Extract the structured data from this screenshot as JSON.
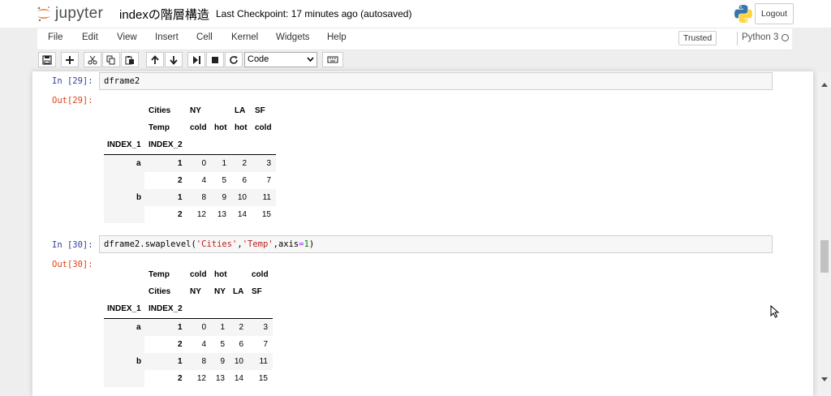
{
  "header": {
    "logo_text": "jupyter",
    "notebook_title": "indexの階層構造",
    "checkpoint_text": "Last Checkpoint: 17 minutes ago (autosaved)",
    "logout_label": "Logout"
  },
  "menu": {
    "items": [
      "File",
      "Edit",
      "View",
      "Insert",
      "Cell",
      "Kernel",
      "Widgets",
      "Help"
    ],
    "trusted_label": "Trusted",
    "kernel_name": "Python 3"
  },
  "toolbar": {
    "buttons": [
      "save-icon",
      "add-cell-icon",
      "cut-icon",
      "copy-icon",
      "paste-icon",
      "move-up-icon",
      "move-down-icon",
      "run-icon",
      "stop-icon",
      "restart-icon"
    ],
    "cell_type": "Code"
  },
  "cells": [
    {
      "in_prompt": "In [29]:",
      "code_plain": "dframe2",
      "out_prompt": "Out[29]:",
      "table": {
        "header1_label": "Cities",
        "header1_cols": [
          "NY",
          "",
          "LA",
          "SF"
        ],
        "header2_label": "Temp",
        "header2_cols": [
          "cold",
          "hot",
          "hot",
          "cold"
        ],
        "index_names": [
          "INDEX_1",
          "INDEX_2"
        ],
        "rows": [
          {
            "i1": "a",
            "i2": "1",
            "values": [
              "0",
              "1",
              "2",
              "3"
            ]
          },
          {
            "i1": "",
            "i2": "2",
            "values": [
              "4",
              "5",
              "6",
              "7"
            ]
          },
          {
            "i1": "b",
            "i2": "1",
            "values": [
              "8",
              "9",
              "10",
              "11"
            ]
          },
          {
            "i1": "",
            "i2": "2",
            "values": [
              "12",
              "13",
              "14",
              "15"
            ]
          }
        ]
      }
    },
    {
      "in_prompt": "In [30]:",
      "code_parts": [
        "dframe2.swaplevel(",
        "'Cities'",
        ",",
        "'Temp'",
        ",axis",
        "=",
        "1",
        ")"
      ],
      "out_prompt": "Out[30]:",
      "table": {
        "header1_label": "Temp",
        "header1_cols": [
          "cold",
          "hot",
          "",
          "cold"
        ],
        "header2_label": "Cities",
        "header2_cols": [
          "NY",
          "NY",
          "LA",
          "SF"
        ],
        "index_names": [
          "INDEX_1",
          "INDEX_2"
        ],
        "rows": [
          {
            "i1": "a",
            "i2": "1",
            "values": [
              "0",
              "1",
              "2",
              "3"
            ]
          },
          {
            "i1": "",
            "i2": "2",
            "values": [
              "4",
              "5",
              "6",
              "7"
            ]
          },
          {
            "i1": "b",
            "i2": "1",
            "values": [
              "8",
              "9",
              "10",
              "11"
            ]
          },
          {
            "i1": "",
            "i2": "2",
            "values": [
              "12",
              "13",
              "14",
              "15"
            ]
          }
        ]
      }
    }
  ]
}
